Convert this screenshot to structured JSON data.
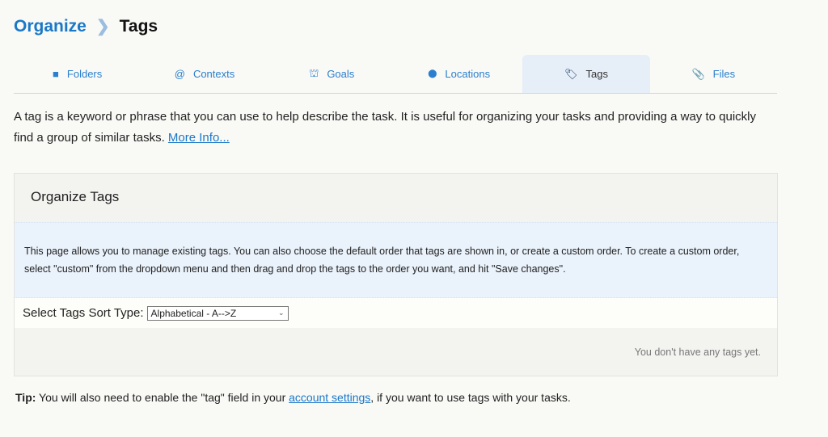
{
  "breadcrumb": {
    "parent": "Organize",
    "current": "Tags"
  },
  "tabs": [
    {
      "label": "Folders",
      "icon": "folder-icon",
      "glyph": "■"
    },
    {
      "label": "Contexts",
      "icon": "at-icon",
      "glyph": "@"
    },
    {
      "label": "Goals",
      "icon": "goals-icon",
      "glyph": "⛫"
    },
    {
      "label": "Locations",
      "icon": "map-pin-icon",
      "glyph": "⬤"
    },
    {
      "label": "Tags",
      "icon": "tag-icon",
      "glyph": "🏷",
      "active": true
    },
    {
      "label": "Files",
      "icon": "paperclip-icon",
      "glyph": "📎"
    }
  ],
  "intro": {
    "text": "A tag is a keyword or phrase that you can use to help describe the task. It is useful for organizing your tasks and providing a way to quickly find a group of similar tasks. ",
    "link": "More Info..."
  },
  "panel": {
    "title": "Organize Tags",
    "info": "This page allows you to manage existing tags. You can also choose the default order that tags are shown in, or create a custom order. To create a custom order, select \"custom\" from the dropdown menu and then drag and drop the tags to the order you want, and hit \"Save changes\".",
    "sort_label": "Select Tags Sort Type:",
    "sort_value": "Alphabetical - A-->Z",
    "empty": "You don't have any tags yet."
  },
  "tip": {
    "label": "Tip:",
    "before": " You will also need to enable the \"tag\" field in your ",
    "link": "account settings",
    "after": ", if you want to use tags with your tasks."
  }
}
